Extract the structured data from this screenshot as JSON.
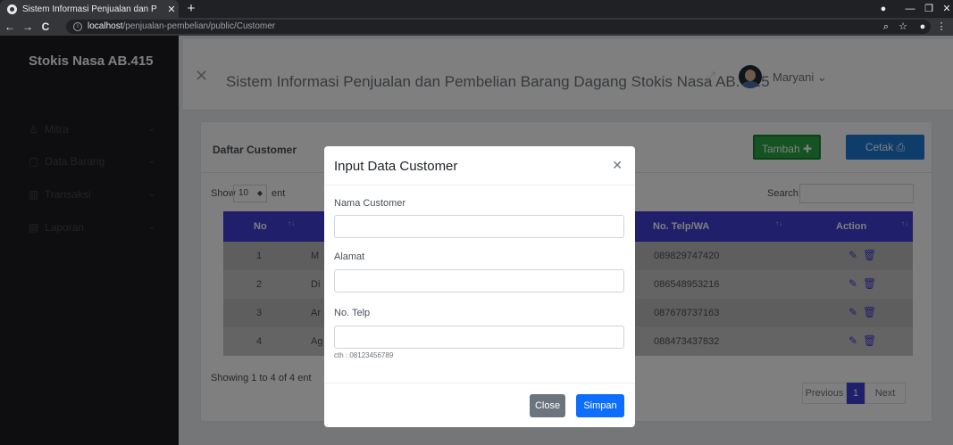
{
  "browser": {
    "tab_title": "Sistem Informasi Penjualan dan P",
    "url_host": "localhost",
    "url_path": "/penjualan-pembelian/public/Customer"
  },
  "sidebar": {
    "brand": "Stokis Nasa AB.415",
    "items": [
      {
        "label": "Mitra",
        "icon": "user-icon"
      },
      {
        "label": "Data Barang",
        "icon": "box-icon"
      },
      {
        "label": "Transaksi",
        "icon": "bar-chart-icon"
      },
      {
        "label": "Laporan",
        "icon": "calendar-icon"
      }
    ]
  },
  "header": {
    "title": "Sistem Informasi Penjualan dan Pembelian Barang Dagang Stokis Nasa AB. 415",
    "user": "Maryani"
  },
  "card": {
    "title": "Daftar Customer",
    "add_label": "Tambah",
    "print_label": "Cetak",
    "show_label": "Show",
    "page_length": "10",
    "entries_label": "ent",
    "search_label": "Search:",
    "columns": {
      "no": "No",
      "phone": "No. Telp/WA",
      "action": "Action"
    },
    "rows": [
      {
        "no": "1",
        "name": "M",
        "phone": "089829747420"
      },
      {
        "no": "2",
        "name": "Di",
        "phone": "086548953216"
      },
      {
        "no": "3",
        "name": "Ar",
        "phone": "087678737163"
      },
      {
        "no": "4",
        "name": "Ag",
        "phone": "088473437832"
      }
    ],
    "showing": "Showing 1 to 4 of 4 ent",
    "pagination": {
      "previous": "Previous",
      "current": "1",
      "next": "Next"
    }
  },
  "modal": {
    "title": "Input Data Customer",
    "fields": [
      {
        "label": "Nama Customer",
        "value": ""
      },
      {
        "label": "Alamat",
        "value": ""
      },
      {
        "label": "No. Telp",
        "value": ""
      }
    ],
    "hint": "cth : 08123456789",
    "close_label": "Close",
    "save_label": "Simpan"
  },
  "colors": {
    "primary": "#3f3fd6",
    "success": "#28a745",
    "sidebar": "#1d1d21"
  }
}
